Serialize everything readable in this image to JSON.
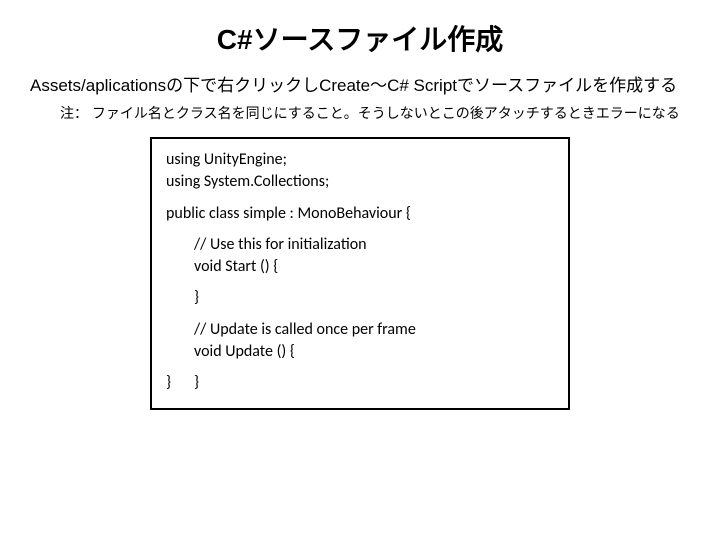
{
  "title": "C#ソースファイル作成",
  "para": "Assets/aplicationsの下で右クリックしCreate～C# Scriptでソースファイルを作成する",
  "note": "注： ファイル名とクラス名を同じにすること。そうしないとこの後アタッチするときエラーになる",
  "code": {
    "l1": "using UnityEngine;",
    "l2": "using System.Collections;",
    "l3": "public class simple : MonoBehaviour {",
    "l4": "// Use this for initialization",
    "l5": "void Start () {",
    "l6": "}",
    "l7": "// Update is called once per frame",
    "l8": "void Update () {",
    "l9": "}",
    "l10": "}"
  }
}
